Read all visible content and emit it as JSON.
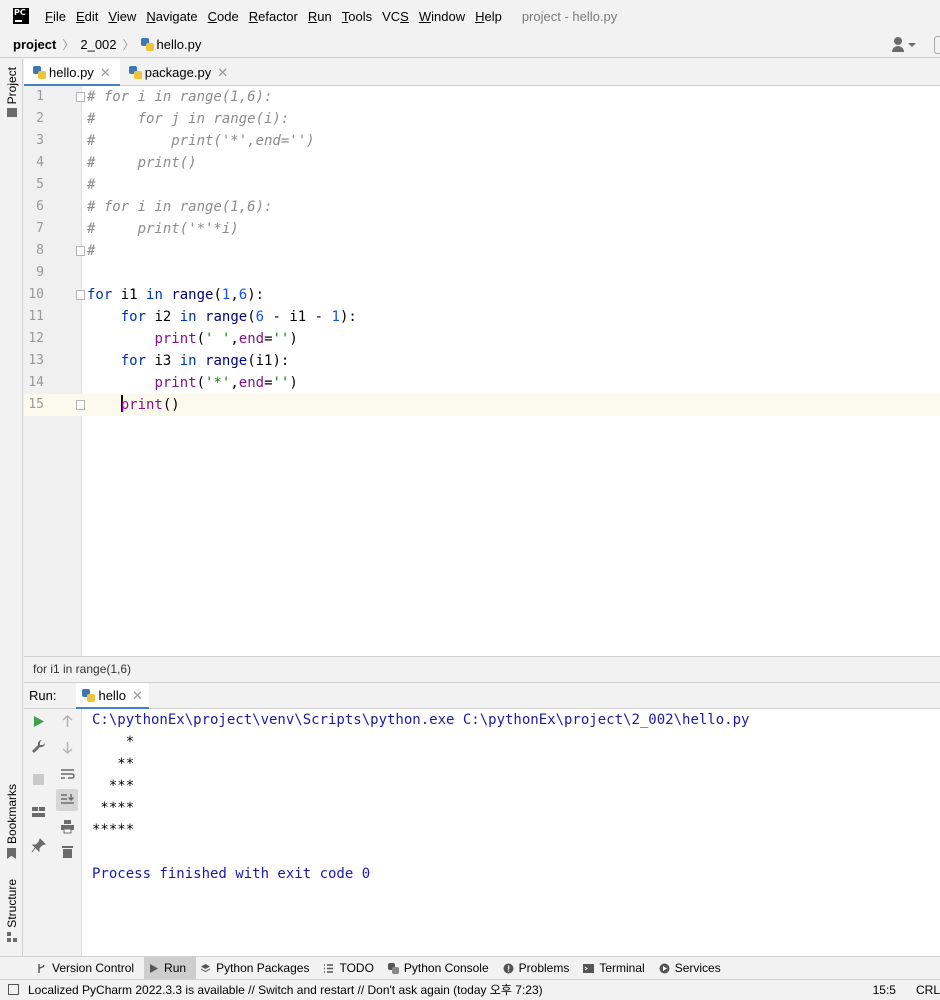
{
  "menubar": {
    "items": [
      {
        "label": "File",
        "mnemonic": "F",
        "rest": "ile"
      },
      {
        "label": "Edit",
        "mnemonic": "E",
        "rest": "dit"
      },
      {
        "label": "View",
        "mnemonic": "V",
        "rest": "iew"
      },
      {
        "label": "Navigate",
        "mnemonic": "N",
        "rest": "avigate"
      },
      {
        "label": "Code",
        "mnemonic": "C",
        "rest": "ode"
      },
      {
        "label": "Refactor",
        "mnemonic": "R",
        "rest": "efactor"
      },
      {
        "label": "Run",
        "mnemonic": "R",
        "rest": "un"
      },
      {
        "label": "Tools",
        "mnemonic": "T",
        "rest": "ools"
      },
      {
        "label": "VCS",
        "mnemonic": "S",
        "rest": ""
      },
      {
        "label": "Window",
        "mnemonic": "W",
        "rest": "indow"
      },
      {
        "label": "Help",
        "mnemonic": "H",
        "rest": "elp"
      }
    ],
    "logo_text": "PC",
    "window_title": "project - hello.py"
  },
  "navbar": {
    "project": "project",
    "folder": "2_002",
    "file": "hello.py"
  },
  "left_strip": {
    "project": "Project",
    "bookmarks": "Bookmarks",
    "structure": "Structure"
  },
  "tabs": [
    {
      "label": "hello.py"
    },
    {
      "label": "package.py"
    }
  ],
  "editor": {
    "current_line": 15,
    "lines": [
      {
        "num": "1",
        "text": "# for i in range(1,6):"
      },
      {
        "num": "2",
        "text": "#     for j in range(i):"
      },
      {
        "num": "3",
        "text": "#         print('*',end='')"
      },
      {
        "num": "4",
        "text": "#     print()"
      },
      {
        "num": "5",
        "text": "#"
      },
      {
        "num": "6",
        "text": "# for i in range(1,6):"
      },
      {
        "num": "7",
        "text": "#     print('*'*i)"
      },
      {
        "num": "8",
        "text": "#"
      },
      {
        "num": "9",
        "text": ""
      },
      {
        "num": "10",
        "text": "for i1 in range(1,6):"
      },
      {
        "num": "11",
        "text": "    for i2 in range(6 - i1 - 1):"
      },
      {
        "num": "12",
        "text": "        print(' ',end='')"
      },
      {
        "num": "13",
        "text": "    for i3 in range(i1):"
      },
      {
        "num": "14",
        "text": "        print('*',end='')"
      },
      {
        "num": "15",
        "text": "    print()"
      }
    ]
  },
  "code_breadcrumb": "for i1 in range(1,6)",
  "run": {
    "label": "Run:",
    "tab": "hello",
    "output": [
      "C:\\pythonEx\\project\\venv\\Scripts\\python.exe C:\\pythonEx\\project\\2_002\\hello.py",
      "    *",
      "   **",
      "  ***",
      " ****",
      "*****",
      "",
      "Process finished with exit code 0"
    ]
  },
  "tool_windows": [
    {
      "label": "Version Control",
      "icon": "branch-icon"
    },
    {
      "label": "Run",
      "icon": "play-icon"
    },
    {
      "label": "Python Packages",
      "icon": "layers-icon"
    },
    {
      "label": "TODO",
      "icon": "list-icon"
    },
    {
      "label": "Python Console",
      "icon": "python-console-icon"
    },
    {
      "label": "Problems",
      "icon": "problems-icon"
    },
    {
      "label": "Terminal",
      "icon": "terminal-icon"
    },
    {
      "label": "Services",
      "icon": "services-icon"
    }
  ],
  "status": {
    "message": "Localized PyCharm 2022.3.3 is available // Switch and restart // Don't ask again (today 오후 7:23)",
    "position": "15:5",
    "line_sep": "CRL"
  },
  "colors": {
    "accent": "#4083c9",
    "keyword": "#0033b3",
    "comment": "#8c8c8c",
    "string": "#067d17",
    "number": "#1750eb",
    "run_green": "#3ea049"
  }
}
